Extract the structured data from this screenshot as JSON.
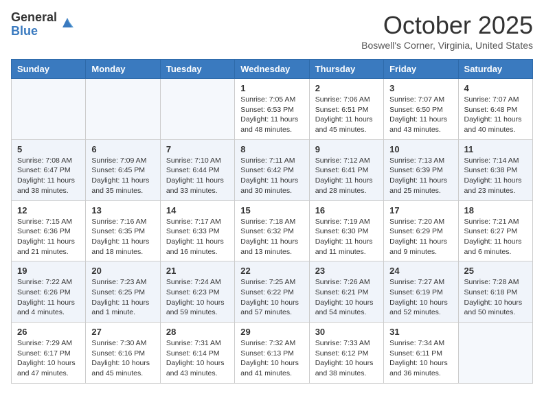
{
  "header": {
    "logo_general": "General",
    "logo_blue": "Blue",
    "month_title": "October 2025",
    "subtitle": "Boswell's Corner, Virginia, United States"
  },
  "weekdays": [
    "Sunday",
    "Monday",
    "Tuesday",
    "Wednesday",
    "Thursday",
    "Friday",
    "Saturday"
  ],
  "weeks": [
    [
      {
        "day": "",
        "info": ""
      },
      {
        "day": "",
        "info": ""
      },
      {
        "day": "",
        "info": ""
      },
      {
        "day": "1",
        "info": "Sunrise: 7:05 AM\nSunset: 6:53 PM\nDaylight: 11 hours and 48 minutes."
      },
      {
        "day": "2",
        "info": "Sunrise: 7:06 AM\nSunset: 6:51 PM\nDaylight: 11 hours and 45 minutes."
      },
      {
        "day": "3",
        "info": "Sunrise: 7:07 AM\nSunset: 6:50 PM\nDaylight: 11 hours and 43 minutes."
      },
      {
        "day": "4",
        "info": "Sunrise: 7:07 AM\nSunset: 6:48 PM\nDaylight: 11 hours and 40 minutes."
      }
    ],
    [
      {
        "day": "5",
        "info": "Sunrise: 7:08 AM\nSunset: 6:47 PM\nDaylight: 11 hours and 38 minutes."
      },
      {
        "day": "6",
        "info": "Sunrise: 7:09 AM\nSunset: 6:45 PM\nDaylight: 11 hours and 35 minutes."
      },
      {
        "day": "7",
        "info": "Sunrise: 7:10 AM\nSunset: 6:44 PM\nDaylight: 11 hours and 33 minutes."
      },
      {
        "day": "8",
        "info": "Sunrise: 7:11 AM\nSunset: 6:42 PM\nDaylight: 11 hours and 30 minutes."
      },
      {
        "day": "9",
        "info": "Sunrise: 7:12 AM\nSunset: 6:41 PM\nDaylight: 11 hours and 28 minutes."
      },
      {
        "day": "10",
        "info": "Sunrise: 7:13 AM\nSunset: 6:39 PM\nDaylight: 11 hours and 25 minutes."
      },
      {
        "day": "11",
        "info": "Sunrise: 7:14 AM\nSunset: 6:38 PM\nDaylight: 11 hours and 23 minutes."
      }
    ],
    [
      {
        "day": "12",
        "info": "Sunrise: 7:15 AM\nSunset: 6:36 PM\nDaylight: 11 hours and 21 minutes."
      },
      {
        "day": "13",
        "info": "Sunrise: 7:16 AM\nSunset: 6:35 PM\nDaylight: 11 hours and 18 minutes."
      },
      {
        "day": "14",
        "info": "Sunrise: 7:17 AM\nSunset: 6:33 PM\nDaylight: 11 hours and 16 minutes."
      },
      {
        "day": "15",
        "info": "Sunrise: 7:18 AM\nSunset: 6:32 PM\nDaylight: 11 hours and 13 minutes."
      },
      {
        "day": "16",
        "info": "Sunrise: 7:19 AM\nSunset: 6:30 PM\nDaylight: 11 hours and 11 minutes."
      },
      {
        "day": "17",
        "info": "Sunrise: 7:20 AM\nSunset: 6:29 PM\nDaylight: 11 hours and 9 minutes."
      },
      {
        "day": "18",
        "info": "Sunrise: 7:21 AM\nSunset: 6:27 PM\nDaylight: 11 hours and 6 minutes."
      }
    ],
    [
      {
        "day": "19",
        "info": "Sunrise: 7:22 AM\nSunset: 6:26 PM\nDaylight: 11 hours and 4 minutes."
      },
      {
        "day": "20",
        "info": "Sunrise: 7:23 AM\nSunset: 6:25 PM\nDaylight: 11 hours and 1 minute."
      },
      {
        "day": "21",
        "info": "Sunrise: 7:24 AM\nSunset: 6:23 PM\nDaylight: 10 hours and 59 minutes."
      },
      {
        "day": "22",
        "info": "Sunrise: 7:25 AM\nSunset: 6:22 PM\nDaylight: 10 hours and 57 minutes."
      },
      {
        "day": "23",
        "info": "Sunrise: 7:26 AM\nSunset: 6:21 PM\nDaylight: 10 hours and 54 minutes."
      },
      {
        "day": "24",
        "info": "Sunrise: 7:27 AM\nSunset: 6:19 PM\nDaylight: 10 hours and 52 minutes."
      },
      {
        "day": "25",
        "info": "Sunrise: 7:28 AM\nSunset: 6:18 PM\nDaylight: 10 hours and 50 minutes."
      }
    ],
    [
      {
        "day": "26",
        "info": "Sunrise: 7:29 AM\nSunset: 6:17 PM\nDaylight: 10 hours and 47 minutes."
      },
      {
        "day": "27",
        "info": "Sunrise: 7:30 AM\nSunset: 6:16 PM\nDaylight: 10 hours and 45 minutes."
      },
      {
        "day": "28",
        "info": "Sunrise: 7:31 AM\nSunset: 6:14 PM\nDaylight: 10 hours and 43 minutes."
      },
      {
        "day": "29",
        "info": "Sunrise: 7:32 AM\nSunset: 6:13 PM\nDaylight: 10 hours and 41 minutes."
      },
      {
        "day": "30",
        "info": "Sunrise: 7:33 AM\nSunset: 6:12 PM\nDaylight: 10 hours and 38 minutes."
      },
      {
        "day": "31",
        "info": "Sunrise: 7:34 AM\nSunset: 6:11 PM\nDaylight: 10 hours and 36 minutes."
      },
      {
        "day": "",
        "info": ""
      }
    ]
  ]
}
